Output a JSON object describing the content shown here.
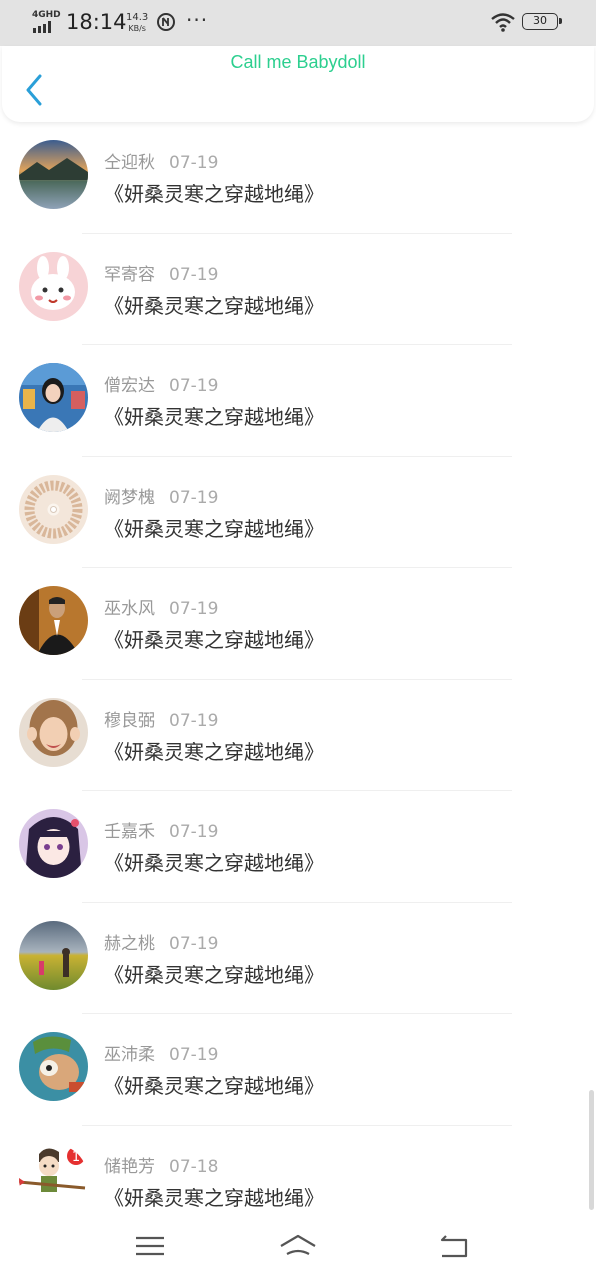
{
  "status_bar": {
    "network": "4GHD",
    "time": "18:14",
    "speed_value": "14.3",
    "speed_unit": "KB/s",
    "dots": "···",
    "battery": "30"
  },
  "header": {
    "title": "Call me Babydoll",
    "title_color": "#2ccf8f",
    "back_icon": "chevron-left-icon"
  },
  "list": [
    {
      "name": "仝迎秋",
      "date": "07-19",
      "content": "《妍桑灵寒之穿越地绳》"
    },
    {
      "name": "罕寄容",
      "date": "07-19",
      "content": "《妍桑灵寒之穿越地绳》"
    },
    {
      "name": "僧宏达",
      "date": "07-19",
      "content": "《妍桑灵寒之穿越地绳》"
    },
    {
      "name": "阙梦槐",
      "date": "07-19",
      "content": "《妍桑灵寒之穿越地绳》"
    },
    {
      "name": "巫水风",
      "date": "07-19",
      "content": "《妍桑灵寒之穿越地绳》"
    },
    {
      "name": "穆良弼",
      "date": "07-19",
      "content": "《妍桑灵寒之穿越地绳》"
    },
    {
      "name": "壬嘉禾",
      "date": "07-19",
      "content": "《妍桑灵寒之穿越地绳》"
    },
    {
      "name": "赫之桃",
      "date": "07-19",
      "content": "《妍桑灵寒之穿越地绳》"
    },
    {
      "name": "巫沛柔",
      "date": "07-19",
      "content": "《妍桑灵寒之穿越地绳》"
    },
    {
      "name": "储艳芳",
      "date": "07-18",
      "content": "《妍桑灵寒之穿越地绳》"
    }
  ],
  "nav_bar": {
    "menu_icon": "menu-icon",
    "home_icon": "home-icon",
    "back_icon": "back-icon"
  }
}
